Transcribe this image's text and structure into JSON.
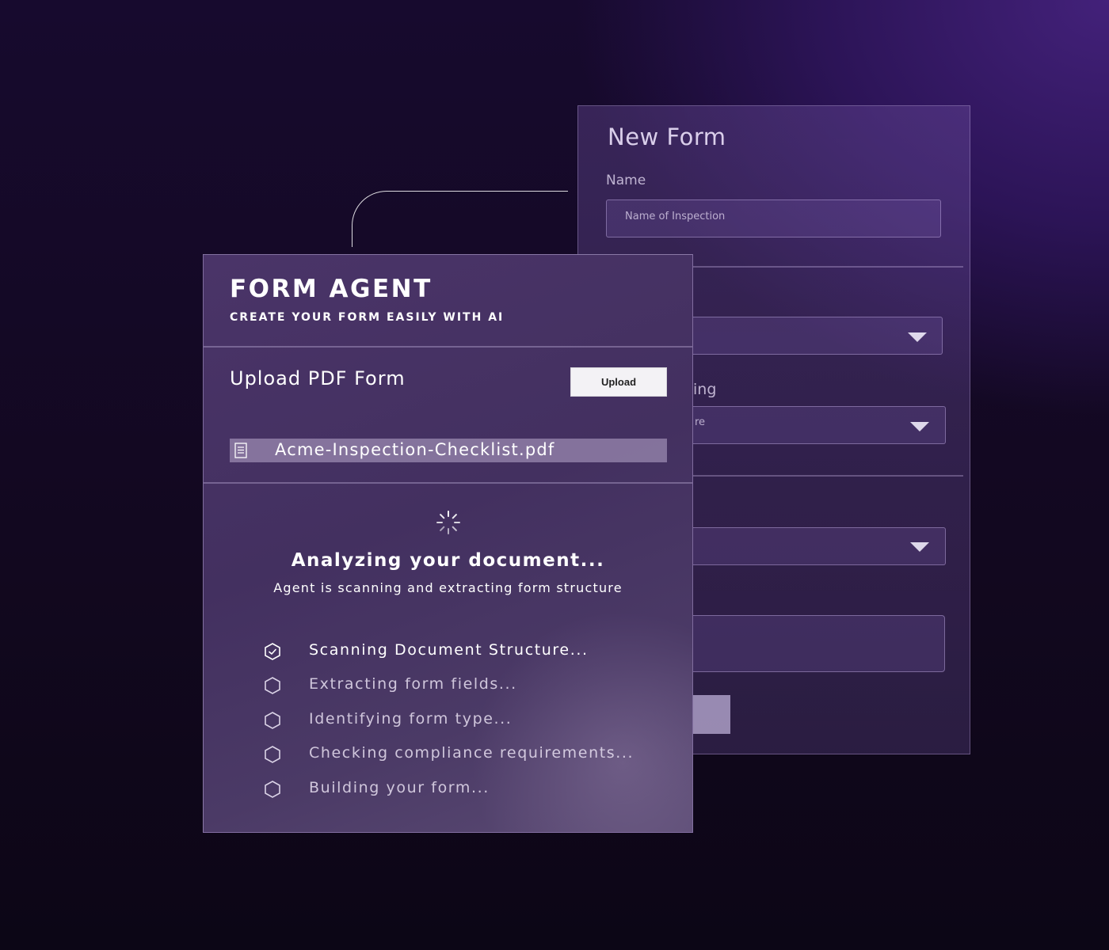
{
  "back_form": {
    "title": "New Form",
    "name_label": "Name",
    "name_placeholder": "Name of Inspection",
    "partial_label": "ing",
    "partial_select_text": "re"
  },
  "agent": {
    "title": "FORM AGENT",
    "subtitle": "CREATE YOUR FORM EASILY WITH AI",
    "upload_title": "Upload PDF Form",
    "upload_button": "Upload",
    "file_name": "Acme-Inspection-Checklist.pdf",
    "status_title": "Analyzing your document...",
    "status_subtitle": "Agent is scanning and extracting form structure",
    "steps": [
      {
        "label": "Scanning Document Structure...",
        "icon": "hexagon-check-icon",
        "state": "active"
      },
      {
        "label": "Extracting form fields...",
        "icon": "hexagon-icon",
        "state": "pending"
      },
      {
        "label": "Identifying form type...",
        "icon": "hexagon-icon",
        "state": "pending"
      },
      {
        "label": "Checking compliance requirements...",
        "icon": "hexagon-icon",
        "state": "pending"
      },
      {
        "label": "Building your form...",
        "icon": "hexagon-icon",
        "state": "pending"
      }
    ]
  }
}
